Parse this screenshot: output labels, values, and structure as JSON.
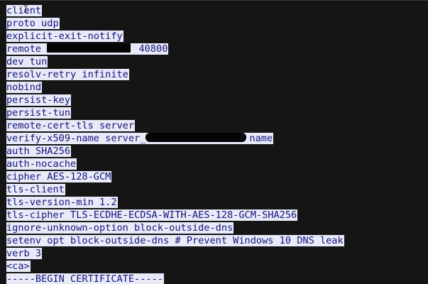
{
  "editor": {
    "lines": [
      {
        "text": "client"
      },
      {
        "text": "proto udp"
      },
      {
        "text": "explicit-exit-notify"
      },
      {
        "pre": "remote ",
        "post": " 40800"
      },
      {
        "text": "dev tun"
      },
      {
        "text": "resolv-retry infinite"
      },
      {
        "text": "nobind"
      },
      {
        "text": "persist-key"
      },
      {
        "text": "persist-tun"
      },
      {
        "text": "remote-cert-tls server"
      },
      {
        "pre": "verify-x509-name server_",
        "post": "name"
      },
      {
        "text": "auth SHA256"
      },
      {
        "text": "auth-nocache"
      },
      {
        "text": "cipher AES-128-GCM"
      },
      {
        "text": "tls-client"
      },
      {
        "text": "tls-version-min 1.2"
      },
      {
        "text": "tls-cipher TLS-ECDHE-ECDSA-WITH-AES-128-GCM-SHA256"
      },
      {
        "text": "ignore-unknown-option block-outside-dns"
      },
      {
        "text": "setenv opt block-outside-dns # Prevent Windows 10 DNS leak"
      },
      {
        "text": "verb 3"
      },
      {
        "text": "<ca>"
      },
      {
        "text": "-----BEGIN CERTIFICATE-----"
      }
    ]
  },
  "colors": {
    "background": "#151515",
    "selection_bg": "#e8eaf8",
    "selection_fg": "#14147a",
    "redaction": "#050505"
  },
  "icons": {
    "cursor": "text-cursor-ibeam-icon"
  }
}
